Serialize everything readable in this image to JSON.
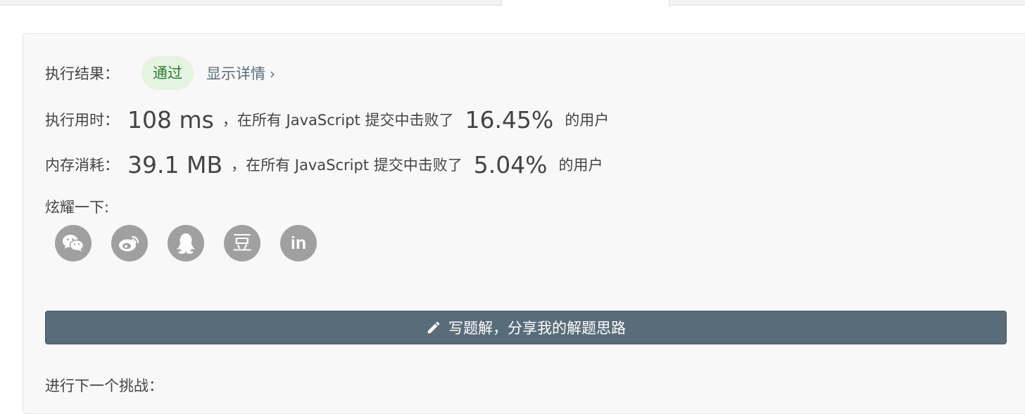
{
  "result": {
    "label": "执行结果：",
    "status": "通过",
    "details_link": "显示详情",
    "chevron": "›"
  },
  "runtime": {
    "label": "执行用时：",
    "value": "108 ms",
    "sep": "，在所有 JavaScript 提交中击败了",
    "percent": "16.45%",
    "suffix": "的用户"
  },
  "memory": {
    "label": "内存消耗：",
    "value": "39.1 MB",
    "sep": "，在所有 JavaScript 提交中击败了",
    "percent": "5.04%",
    "suffix": "的用户"
  },
  "share": {
    "label": "炫耀一下:",
    "icons": [
      "wechat-icon",
      "weibo-icon",
      "qq-icon",
      "douban-icon",
      "linkedin-icon"
    ],
    "douban_glyph": "豆",
    "linkedin_glyph": "in"
  },
  "write_solution": {
    "label": "写题解，分享我的解题思路",
    "icon": "pencil-icon"
  },
  "next_challenge": {
    "label": "进行下一个挑战："
  },
  "colors": {
    "badge_bg": "#e5f3e1",
    "badge_text": "#2e7d32",
    "button_bg": "#596c79",
    "social_bg": "#a0a0a0"
  }
}
